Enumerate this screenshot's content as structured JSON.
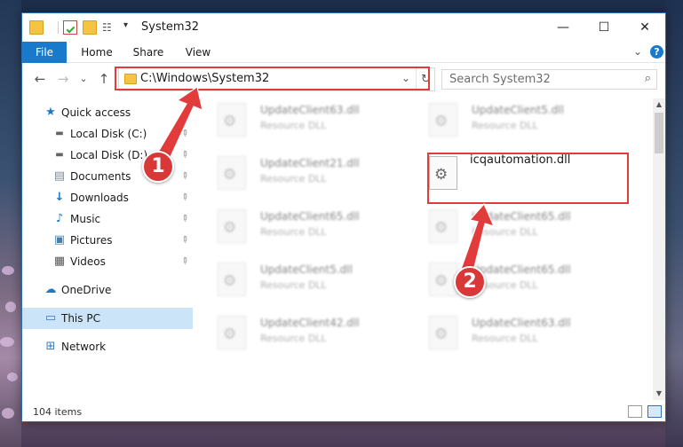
{
  "window": {
    "title": "System32",
    "minimize_glyph": "—",
    "maximize_glyph": "☐",
    "close_glyph": "✕"
  },
  "ribbon": {
    "tabs": [
      "File",
      "Home",
      "Share",
      "View"
    ],
    "expand_glyph": "⌄",
    "help_glyph": "?"
  },
  "nav": {
    "back_glyph": "←",
    "forward_glyph": "→",
    "recent_glyph": "⌄",
    "up_glyph": "↑",
    "address": "C:\\Windows\\System32",
    "address_dropdown_glyph": "⌄",
    "refresh_glyph": "↻",
    "search_placeholder": "Search System32",
    "search_glyph": "⌕"
  },
  "sidebar": {
    "items": [
      {
        "label": "Quick access",
        "icon": "star-icon"
      },
      {
        "label": "Local Disk (C:)",
        "icon": "drive-icon",
        "pinned": true
      },
      {
        "label": "Local Disk (D:)",
        "icon": "drive-icon",
        "pinned": true
      },
      {
        "label": "Documents",
        "icon": "documents-icon",
        "pinned": true
      },
      {
        "label": "Downloads",
        "icon": "download-icon",
        "pinned": true
      },
      {
        "label": "Music",
        "icon": "music-icon",
        "pinned": true
      },
      {
        "label": "Pictures",
        "icon": "pictures-icon",
        "pinned": true
      },
      {
        "label": "Videos",
        "icon": "videos-icon",
        "pinned": true
      },
      {
        "label": "OneDrive",
        "icon": "cloud-icon"
      },
      {
        "label": "This PC",
        "icon": "computer-icon",
        "selected": true
      },
      {
        "label": "Network",
        "icon": "network-icon"
      }
    ]
  },
  "files": {
    "left_column": [
      {
        "name": "UpdateClient63.dll",
        "type": "Resource DLL"
      },
      {
        "name": "UpdateClient21.dll",
        "type": "Resource DLL"
      },
      {
        "name": "UpdateClient65.dll",
        "type": "Resource DLL"
      },
      {
        "name": "UpdateClient5.dll",
        "type": "Resource DLL"
      },
      {
        "name": "UpdateClient42.dll",
        "type": "Resource DLL"
      }
    ],
    "right_column": [
      {
        "name": "UpdateClient5.dll",
        "type": "Resource DLL"
      },
      {
        "name": "icqautomation.dll",
        "type": ""
      },
      {
        "name": "UpdateClient65.dll",
        "type": "Resource DLL"
      },
      {
        "name": "UpdateClient65.dll",
        "type": "Resource DLL"
      },
      {
        "name": "UpdateClient63.dll",
        "type": "Resource DLL"
      }
    ]
  },
  "status": {
    "item_count": "104 items"
  },
  "annotations": {
    "marker_1": "1",
    "marker_2": "2",
    "highlight_color": "#e13b3b"
  },
  "colors": {
    "accent": "#1979ca",
    "selection": "#cce4f7"
  }
}
